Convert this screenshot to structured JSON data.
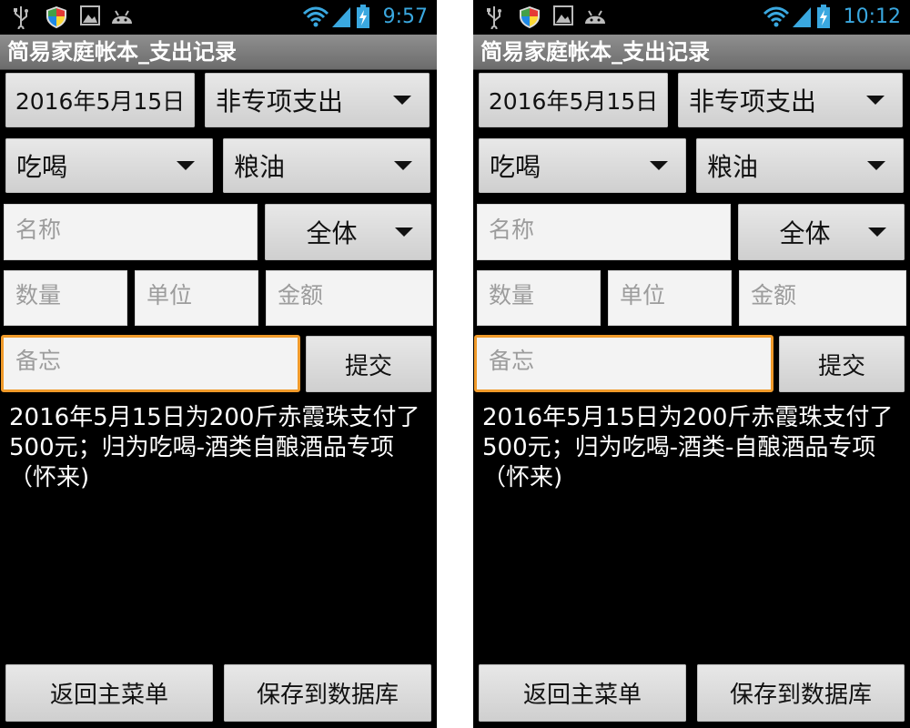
{
  "screens": [
    {
      "status": {
        "time": "9:57"
      },
      "title": "简易家庭帐本_支出记录",
      "date_button": "2016年5月15日",
      "type_spinner": "非专项支出",
      "category_spinner": "吃喝",
      "subcategory_spinner": "粮油",
      "name_placeholder": "名称",
      "scope_spinner": "全体",
      "quantity_placeholder": "数量",
      "unit_placeholder": "单位",
      "amount_placeholder": "金额",
      "memo_placeholder": "备忘",
      "submit_button": "提交",
      "summary_text": "2016年5月15日为200斤赤霞珠支付了500元；归为吃喝-酒类自酿酒品专项（怀来)",
      "back_button": "返回主菜单",
      "save_button": "保存到数据库"
    },
    {
      "status": {
        "time": "10:12"
      },
      "title": "简易家庭帐本_支出记录",
      "date_button": "2016年5月15日",
      "type_spinner": "非专项支出",
      "category_spinner": "吃喝",
      "subcategory_spinner": "粮油",
      "name_placeholder": "名称",
      "scope_spinner": "全体",
      "quantity_placeholder": "数量",
      "unit_placeholder": "单位",
      "amount_placeholder": "金额",
      "memo_placeholder": "备忘",
      "submit_button": "提交",
      "summary_text": "2016年5月15日为200斤赤霞珠支付了500元；归为吃喝-酒类-自酿酒品专项（怀来)",
      "back_button": "返回主菜单",
      "save_button": "保存到数据库"
    }
  ],
  "colors": {
    "accent_time": "#3aa8e0",
    "focus_border": "#f09a2a",
    "title_bar": "#7d7d7d"
  },
  "icons": [
    "usb-icon",
    "shield-icon",
    "image-icon",
    "android-icon",
    "wifi-icon",
    "signal-icon",
    "battery-charging-icon"
  ]
}
